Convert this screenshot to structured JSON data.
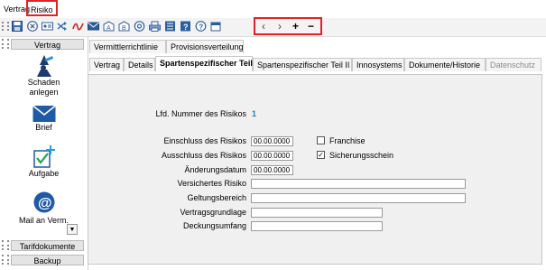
{
  "menu": {
    "vertrag": "Vertrag",
    "risiko": "Risiko"
  },
  "toolbar": {
    "icons": [
      "save-icon",
      "cancel-icon",
      "id-card-icon",
      "shuffle-icon",
      "signature-icon",
      "mail-icon",
      "letter-a-icon",
      "letter-b-icon",
      "at-icon",
      "printer-icon",
      "list-icon",
      "help-icon",
      "question-icon",
      "export-icon"
    ],
    "nav": {
      "prev": "‹",
      "next": "›",
      "add": "+",
      "remove": "−"
    }
  },
  "sidebar": {
    "header": "Vertrag",
    "items": [
      {
        "label_line1": "Schaden",
        "label_line2": "anlegen",
        "icon": "damage-icon"
      },
      {
        "label_line1": "Brief",
        "label_line2": "",
        "icon": "envelope-icon"
      },
      {
        "label_line1": "Aufgabe",
        "label_line2": "",
        "icon": "task-icon"
      },
      {
        "label_line1": "Mail an Verm.",
        "label_line2": "",
        "icon": "at-icon"
      }
    ],
    "footer_buttons": [
      "Tarifdokumente",
      "Backup"
    ]
  },
  "tabs_top": [
    "Vermittlerrichtlinie",
    "Provisionsverteilung"
  ],
  "tabs_main": [
    "Vertrag",
    "Details",
    "Spartenspezifischer Teil I",
    "Spartenspezifischer Teil II",
    "Innosystems",
    "Dokumente/Historie",
    "Datenschutz"
  ],
  "form": {
    "lfd_label": "Lfd. Nummer des Risikos",
    "lfd_value": "1",
    "einschluss_label": "Einschluss des Risikos",
    "einschluss_value": "00.00.0000",
    "ausschluss_label": "Ausschluss des Risikos",
    "ausschluss_value": "00.00.0000",
    "aenderung_label": "Änderungsdatum",
    "aenderung_value": "00.00.0000",
    "versichertes_label": "Versichertes Risiko",
    "versichertes_value": "",
    "geltung_label": "Geltungsbereich",
    "geltung_value": "",
    "vertragsgrundlage_label": "Vertragsgrundlage",
    "vertragsgrundlage_value": "",
    "deckung_label": "Deckungsumfang",
    "deckung_value": "",
    "franchise_label": "Franchise",
    "franchise_checked": false,
    "sicherung_label": "Sicherungsschein",
    "sicherung_checked": true
  },
  "colors": {
    "highlight": "#e0202a",
    "accent": "#1c7fc1",
    "tab_active": "#ffffff",
    "panel_bg": "#f0f0f0"
  }
}
